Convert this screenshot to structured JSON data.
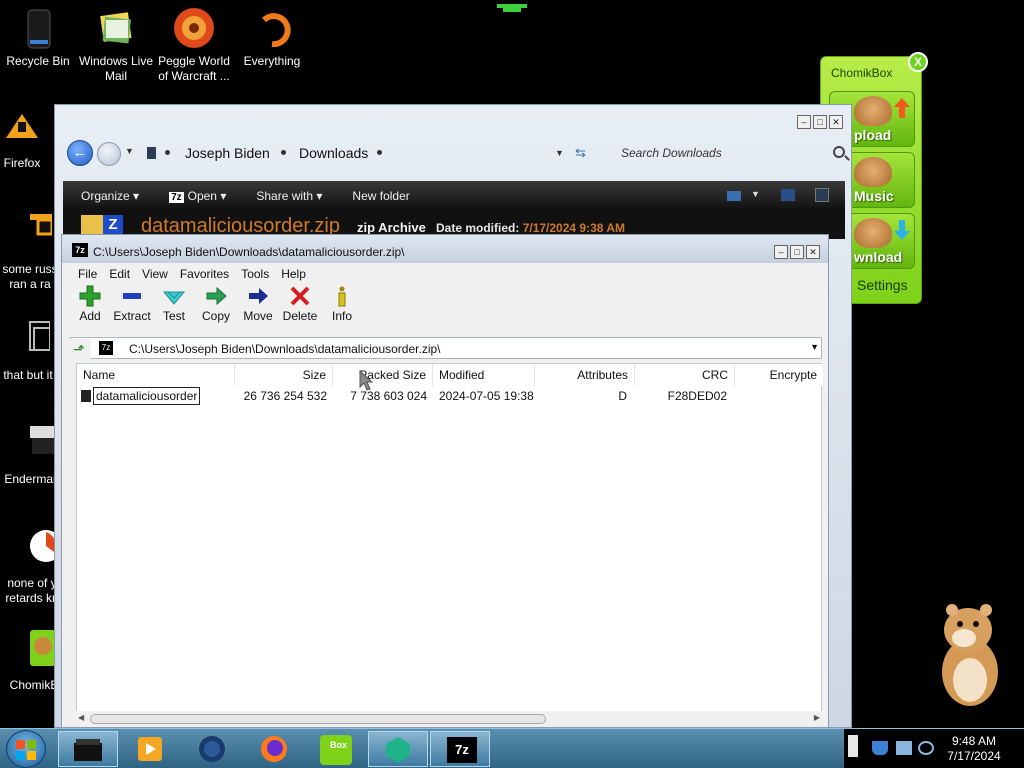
{
  "desktop": {
    "icons": [
      {
        "label": "Recycle Bin"
      },
      {
        "label": "Windows Live Mail"
      },
      {
        "label": "Peggle World of Warcraft ..."
      },
      {
        "label": "Everything"
      },
      {
        "label": "Firefox"
      },
      {
        "label": "some russ ran a ra"
      },
      {
        "label": "that but it"
      },
      {
        "label": "Enderman"
      },
      {
        "label": "none of y retards kn"
      },
      {
        "label": "ChomikB"
      }
    ]
  },
  "chomikbox": {
    "title": "ChomikBox",
    "close": "X",
    "buttons": [
      "Upload",
      "Music",
      "Download"
    ],
    "button_visible": [
      "pload",
      "Music",
      "wnload"
    ],
    "settings": "Settings"
  },
  "explorer": {
    "breadcrumb": [
      "Joseph Biden",
      "Downloads"
    ],
    "search_placeholder": "Search Downloads",
    "toolbar": [
      "Organize",
      "Open",
      "Share with",
      "New folder"
    ],
    "details": {
      "file_name": "datamaliciousorder.zip",
      "file_type": "zip Archive",
      "modified_label": "Date modified:",
      "modified_value": "7/17/2024 9:38 AM"
    }
  },
  "sevenzip": {
    "title": "C:\\Users\\Joseph Biden\\Downloads\\datamaliciousorder.zip\\",
    "menu": [
      "File",
      "Edit",
      "View",
      "Favorites",
      "Tools",
      "Help"
    ],
    "tools": [
      "Add",
      "Extract",
      "Test",
      "Copy",
      "Move",
      "Delete",
      "Info"
    ],
    "path": "C:\\Users\\Joseph Biden\\Downloads\\datamaliciousorder.zip\\",
    "columns": [
      "Name",
      "Size",
      "Packed Size",
      "Modified",
      "Attributes",
      "CRC",
      "Encrypte"
    ],
    "rows": [
      {
        "name": "datamaliciousorder",
        "size": "26 736 254 532",
        "packed": "7 738 603 024",
        "modified": "2024-07-05 19:38",
        "attributes": "D",
        "crc": "F28DED02",
        "encrypted": ""
      }
    ]
  },
  "taskbar": {
    "time": "9:48 AM",
    "date": "7/17/2024",
    "zip_label": "7z",
    "box_label": "Box"
  },
  "colors": {
    "chomik_green": "#7ed21a",
    "explorer_toolbar": "#1a1a1a",
    "filename_orange": "#d07a28",
    "taskbar_blue": "#3f7698"
  }
}
